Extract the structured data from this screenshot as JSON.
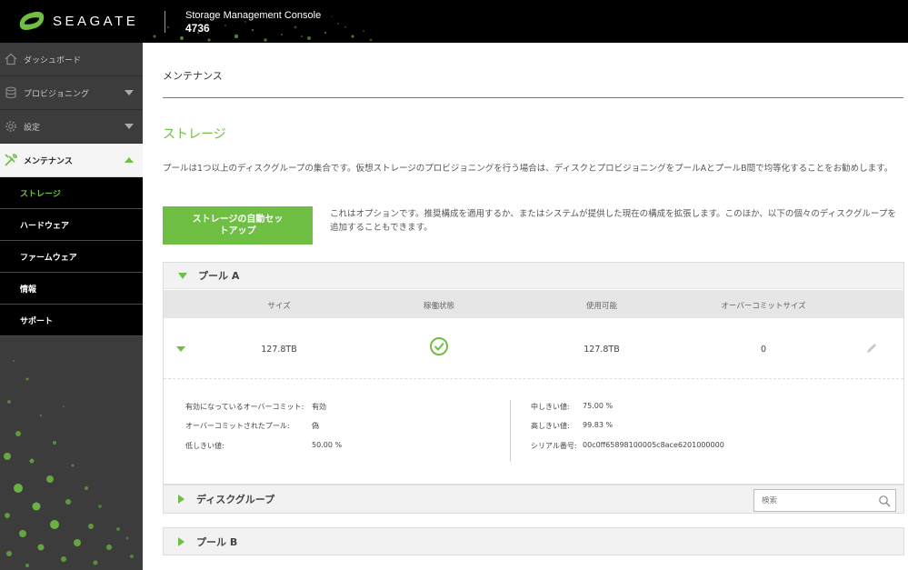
{
  "header": {
    "brand": "SEAGATE",
    "console_title": "Storage Management Console",
    "console_id": "4736"
  },
  "sidebar": {
    "items": [
      {
        "label": "ダッシュボード",
        "icon": "home-icon"
      },
      {
        "label": "プロビジョニング",
        "icon": "database-icon"
      },
      {
        "label": "設定",
        "icon": "gear-icon"
      },
      {
        "label": "メンテナンス",
        "icon": "tools-icon"
      }
    ],
    "subitems": [
      {
        "label": "ストレージ"
      },
      {
        "label": "ハードウェア"
      },
      {
        "label": "ファームウェア"
      },
      {
        "label": "情報"
      },
      {
        "label": "サポート"
      }
    ]
  },
  "main": {
    "breadcrumb": "メンテナンス",
    "section_title": "ストレージ",
    "description": "プールは1つ以上のディスクグループの集合です。仮想ストレージのプロビジョニングを行う場合は、ディスクとプロビジョニングをプールAとプールB間で均等化することをお勧めします。",
    "auto_setup_button": "ストレージの自動セットアップ",
    "option_text": "これはオプションです。推奨構成を適用するか、またはシステムが提供した現在の構成を拡張します。このほか、以下の個々のディスクグループを追加することもできます。",
    "pool_a": {
      "name": "プール A",
      "columns": [
        "サイズ",
        "稼働状態",
        "使用可能",
        "オーバーコミットサイズ"
      ],
      "row": {
        "size": "127.8TB",
        "health": "ok",
        "available": "127.8TB",
        "overcommit_size": "0"
      },
      "details_left": [
        {
          "key": "有効になっているオーバーコミット:",
          "value": "有効"
        },
        {
          "key": "オーバーコミットされたプール:",
          "value": "偽"
        },
        {
          "key": "低しきい値:",
          "value": "50.00 %"
        }
      ],
      "details_right": [
        {
          "key": "中しきい値:",
          "value": "75.00 %"
        },
        {
          "key": "高しきい値:",
          "value": "99.83 %"
        },
        {
          "key": "シリアル番号:",
          "value": "00c0ff65898100005c8ace6201000000"
        }
      ]
    },
    "disk_group": {
      "name": "ディスクグループ",
      "search_placeholder": "検索"
    },
    "pool_b": {
      "name": "プール B"
    }
  },
  "colors": {
    "accent": "#6fbf44",
    "sidebar_bg": "#3c3c3c",
    "header_bg": "#000000"
  }
}
